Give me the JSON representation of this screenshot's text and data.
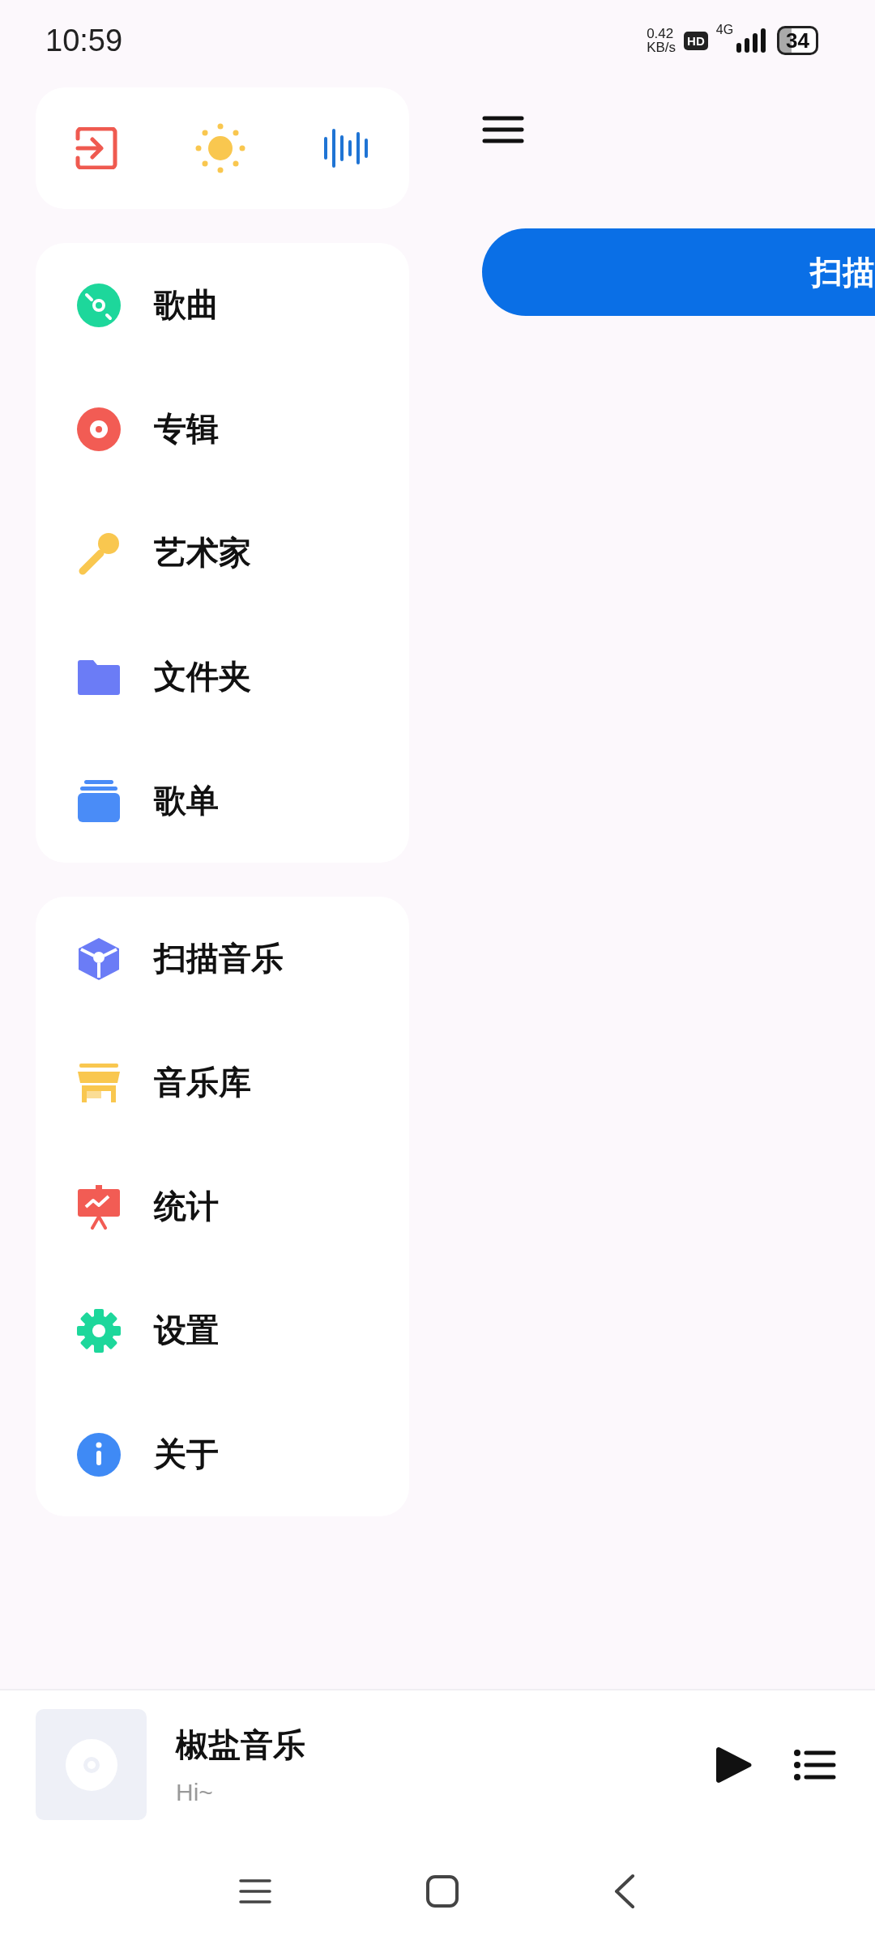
{
  "status_bar": {
    "time": "10:59",
    "net_speed": "0.42",
    "net_unit": "KB/s",
    "hd_badge": "HD",
    "network": "4G",
    "battery": "34"
  },
  "drawer": {
    "quick_actions": [
      {
        "kind": "exit"
      },
      {
        "kind": "theme"
      },
      {
        "kind": "equalizer"
      }
    ],
    "library_items": [
      {
        "label": "歌曲"
      },
      {
        "label": "专辑"
      },
      {
        "label": "艺术家"
      },
      {
        "label": "文件夹"
      },
      {
        "label": "歌单"
      }
    ],
    "tool_items": [
      {
        "label": "扫描音乐"
      },
      {
        "label": "音乐库"
      },
      {
        "label": "统计"
      },
      {
        "label": "设置"
      },
      {
        "label": "关于"
      }
    ]
  },
  "main": {
    "scan_button": "扫描"
  },
  "player": {
    "title": "椒盐音乐",
    "subtitle": "Hi~"
  }
}
